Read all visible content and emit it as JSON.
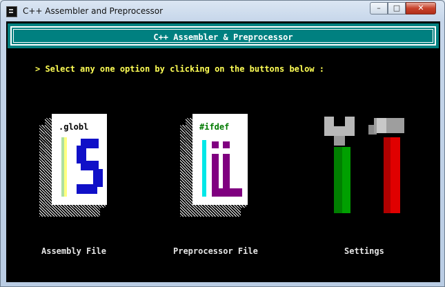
{
  "window": {
    "title": "C++ Assembler and Preprocessor"
  },
  "controls": {
    "minimize": "–",
    "maximize": "□",
    "close": "✕"
  },
  "header": {
    "title": "C++ Assembler & Preprocessor"
  },
  "prompt": "> Select any one option by clicking on the buttons below :",
  "options": [
    {
      "label": "Assembly File",
      "icon_text": ".globl",
      "icon": "assembly-file-icon",
      "accent": "#1010c8"
    },
    {
      "label": "Preprocessor File",
      "icon_text": "#ifdef",
      "icon": "preprocessor-file-icon",
      "accent": "#800080"
    },
    {
      "label": "Settings",
      "icon": "wrench-hammer-icon"
    }
  ],
  "colors": {
    "console_bg": "#000000",
    "header_bg": "#008080",
    "prompt": "#ffff55"
  }
}
